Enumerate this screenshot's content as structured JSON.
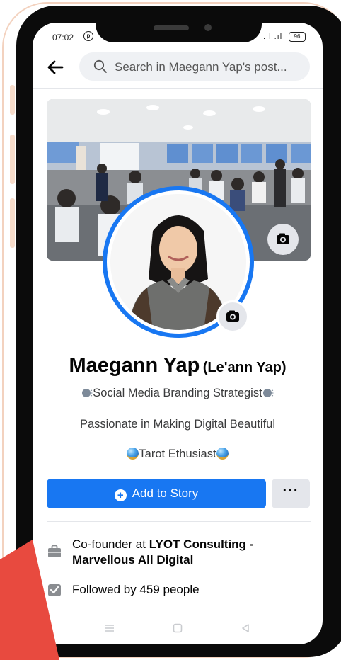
{
  "status": {
    "time": "07:02",
    "signal": ".ıl .ıl",
    "battery": "96"
  },
  "search": {
    "placeholder": "Search in Maegann Yap's post..."
  },
  "profile": {
    "name": "Maegann Yap",
    "alt_name": "(Le'ann Yap)",
    "bio_line1": "Social Media Branding Strategist",
    "bio_line2": "Passionate in Making Digital Beautiful",
    "bio_line3": "Tarot Ethusiast"
  },
  "actions": {
    "add_story": "Add to Story",
    "more": "···"
  },
  "details": {
    "work_prefix": "Co-founder at ",
    "work_company": "LYOT Consulting - Marvellous All Digital",
    "followers": "Followed by 459 people"
  },
  "colors": {
    "accent": "#1877f2",
    "ring": "#1877f2",
    "red_shape": "#e84a3f"
  },
  "icons": [
    "message-icon",
    "back-arrow-icon",
    "search-icon",
    "camera-icon",
    "plus-icon",
    "briefcase-icon",
    "followers-icon",
    "menu-icon",
    "home-icon",
    "back-triangle-icon"
  ]
}
